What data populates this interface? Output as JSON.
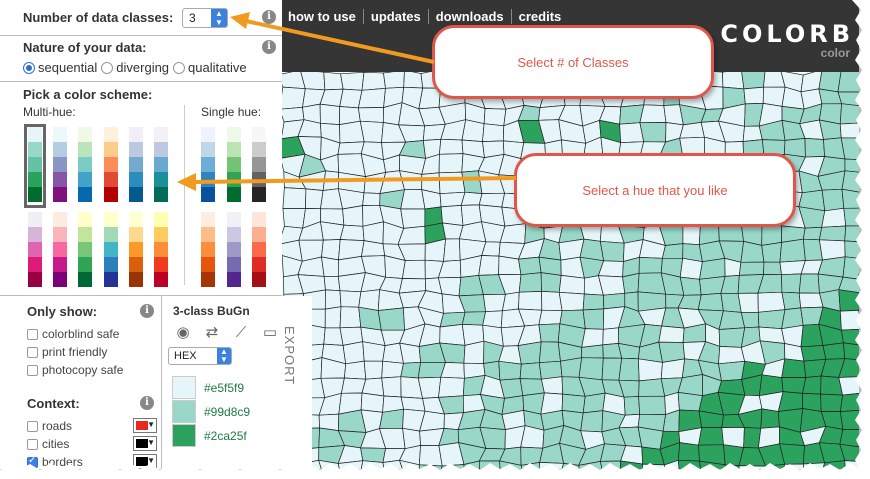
{
  "panel": {
    "classes": {
      "label": "Number of data classes:",
      "value": "3"
    },
    "nature": {
      "label": "Nature of your data:",
      "options": [
        {
          "label": "sequential",
          "selected": true
        },
        {
          "label": "diverging",
          "selected": false
        },
        {
          "label": "qualitative",
          "selected": false
        }
      ]
    },
    "scheme": {
      "label": "Pick a color scheme:",
      "multi_label": "Multi-hue:",
      "single_label": "Single hue:",
      "multi_row1": [
        [
          "#e5f5f9",
          "#99d8c9",
          "#66c2a4",
          "#2ca25f",
          "#006d2c"
        ],
        [
          "#edf8fb",
          "#b3cde3",
          "#8c96c6",
          "#8856a7",
          "#810f7c"
        ],
        [
          "#f0f9e8",
          "#bae4bc",
          "#7bccc4",
          "#43a2ca",
          "#0868ac"
        ],
        [
          "#fef0d9",
          "#fdcc8a",
          "#fc8d59",
          "#e34a33",
          "#b30000"
        ],
        [
          "#f1eef6",
          "#bdc9e1",
          "#74a9cf",
          "#2b8cbe",
          "#045a8d"
        ],
        [
          "#f6eff7",
          "#bdc9e1",
          "#67a9cf",
          "#1c9099",
          "#016c59"
        ]
      ],
      "multi_row2": [
        [
          "#f1eef6",
          "#d7b5d8",
          "#df65b0",
          "#dd1c77",
          "#980043"
        ],
        [
          "#feebe2",
          "#fbb4b9",
          "#f768a1",
          "#c51b8a",
          "#7a0177"
        ],
        [
          "#ffffcc",
          "#c2e699",
          "#78c679",
          "#31a354",
          "#006837"
        ],
        [
          "#ffffcc",
          "#a1dab4",
          "#41b6c4",
          "#2c7fb8",
          "#253494"
        ],
        [
          "#ffffd4",
          "#fed98e",
          "#fe9929",
          "#d95f0e",
          "#993404"
        ],
        [
          "#ffffb2",
          "#fecc5c",
          "#fd8d3c",
          "#f03b20",
          "#bd0026"
        ]
      ],
      "single_row1": [
        [
          "#eff3ff",
          "#bdd7e7",
          "#6baed6",
          "#3182bd",
          "#08519c"
        ],
        [
          "#edf8e9",
          "#bae4b3",
          "#74c476",
          "#31a354",
          "#006d2c"
        ],
        [
          "#f7f7f7",
          "#cccccc",
          "#969696",
          "#636363",
          "#252525"
        ]
      ],
      "single_row2": [
        [
          "#feedde",
          "#fdbe85",
          "#fd8d3c",
          "#e6550d",
          "#a63603"
        ],
        [
          "#f2f0f7",
          "#cbc9e2",
          "#9e9ac8",
          "#756bb1",
          "#54278f"
        ],
        [
          "#fee5d9",
          "#fcae91",
          "#fb6a4a",
          "#de2d26",
          "#a50f15"
        ]
      ]
    },
    "only_show": {
      "label": "Only show:",
      "items": [
        {
          "label": "colorblind safe",
          "checked": false
        },
        {
          "label": "print friendly",
          "checked": false
        },
        {
          "label": "photocopy safe",
          "checked": false
        }
      ]
    },
    "context": {
      "label": "Context:",
      "items": [
        {
          "label": "roads",
          "checked": false,
          "color": "#e8281c"
        },
        {
          "label": "cities",
          "checked": false,
          "color": "#000000"
        },
        {
          "label": "borders",
          "checked": true,
          "color": "#000000"
        }
      ]
    },
    "export": {
      "title": "3-class BuGn",
      "format": "HEX",
      "label": "EXPORT",
      "colors": [
        "#e5f5f9",
        "#99d8c9",
        "#2ca25f"
      ],
      "codes": [
        "#e5f5f9",
        "#99d8c9",
        "#2ca25f"
      ]
    }
  },
  "nav": {
    "links": [
      "how to use",
      "updates",
      "downloads",
      "credits"
    ],
    "logo": "COLORB",
    "logo_sub": "color"
  },
  "callouts": {
    "classes": "Select # of Classes",
    "hue": "Select a hue that you like"
  },
  "icons": {
    "info": "info-icon",
    "view": "eye-icon",
    "export_file": "export-file-icon",
    "graph": "graph-icon",
    "book": "book-icon"
  },
  "colors": {
    "arrow": "#f29a1f",
    "callout": "#e0574a",
    "topbar": "#353535",
    "map_light": "#e5f5f9",
    "map_mid": "#99d8c9",
    "map_dark": "#2ca25f"
  }
}
